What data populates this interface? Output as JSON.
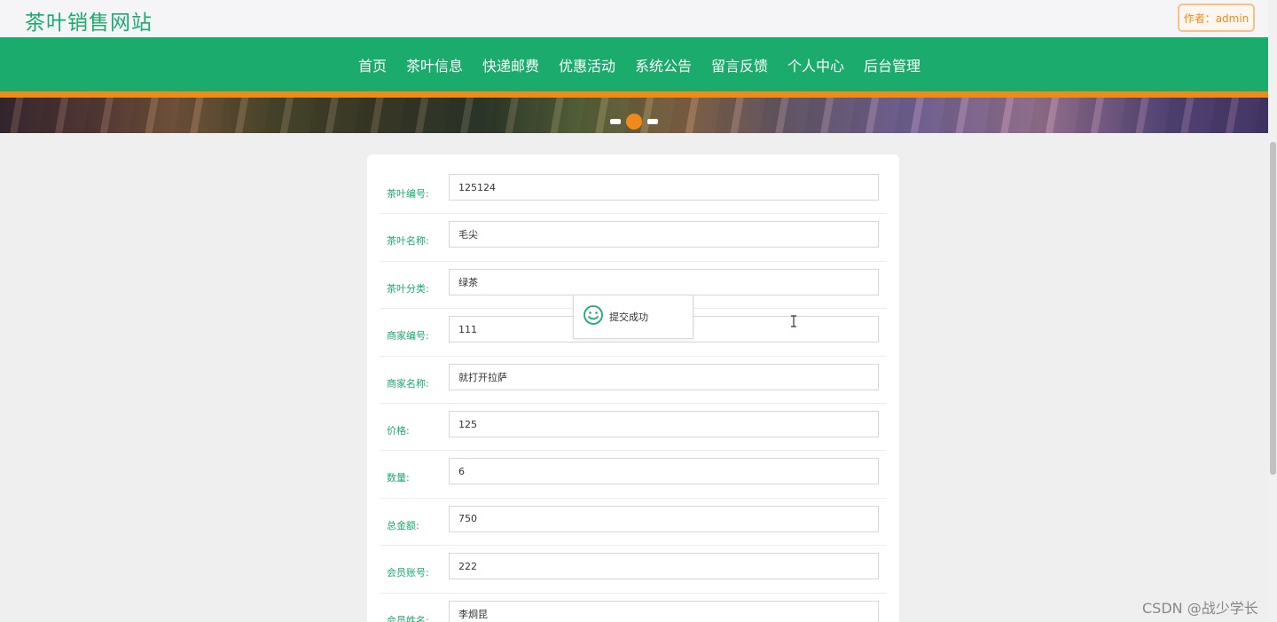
{
  "header": {
    "site_title": "茶叶销售网站",
    "author_badge": "作者：admin"
  },
  "nav": {
    "items": [
      "首页",
      "茶叶信息",
      "快递邮费",
      "优惠活动",
      "系统公告",
      "留言反馈",
      "个人中心",
      "后台管理"
    ]
  },
  "banner": {
    "dot_count": 3,
    "active_dot": 1
  },
  "form": {
    "fields": [
      {
        "label": "茶叶编号:",
        "value": "125124"
      },
      {
        "label": "茶叶名称:",
        "value": "毛尖"
      },
      {
        "label": "茶叶分类:",
        "value": "绿茶"
      },
      {
        "label": "商家编号:",
        "value": "111"
      },
      {
        "label": "商家名称:",
        "value": "就打开拉萨"
      },
      {
        "label": "价格:",
        "value": "125"
      },
      {
        "label": "数量:",
        "value": "6"
      },
      {
        "label": "总金额:",
        "value": "750"
      },
      {
        "label": "会员账号:",
        "value": "222"
      },
      {
        "label": "会员姓名:",
        "value": "李炯昆"
      }
    ]
  },
  "toast": {
    "icon": "smile-icon",
    "message": "提交成功"
  },
  "watermark": "CSDN @战少学长",
  "colors": {
    "brand_green": "#1aab6d",
    "accent_orange": "#f08a1a"
  }
}
